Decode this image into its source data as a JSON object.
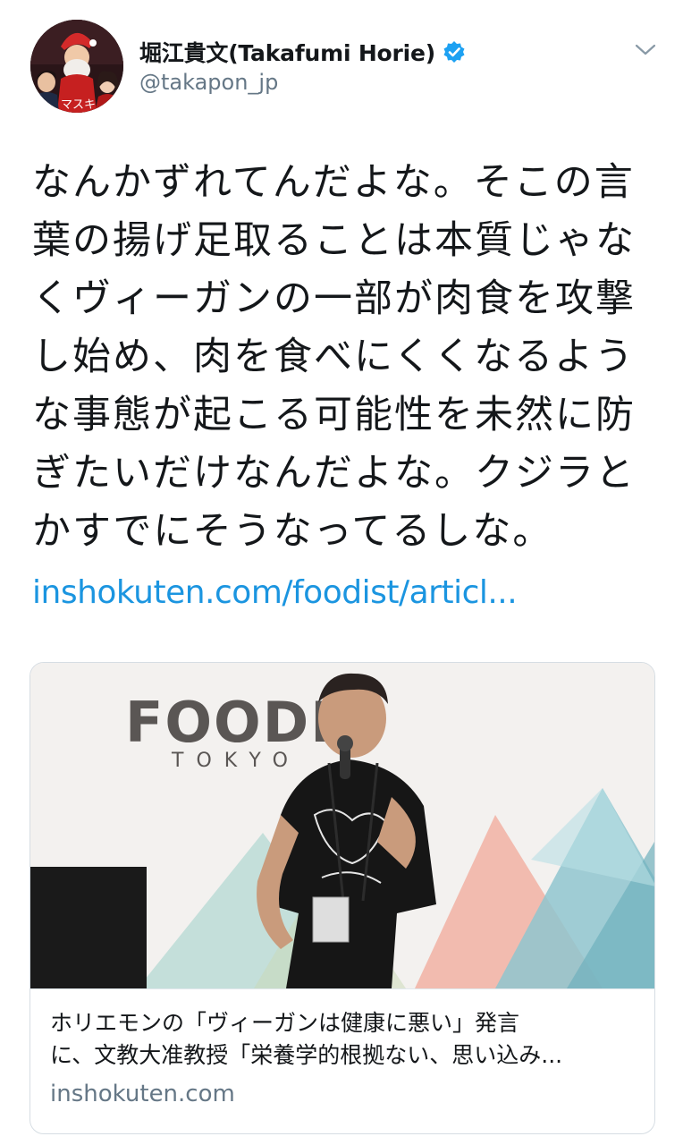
{
  "user": {
    "display_name": "堀江貴文(Takafumi Horie)",
    "handle": "@takapon_jp",
    "avatar_caption": "マスキ",
    "verified": true
  },
  "tweet": {
    "text": "なんかずれてんだよな。そこの言\n葉の揚げ足取ることは本質じゃな\nくヴィーガンの一部が肉食を攻撃\nし始め、肉を食べにくくなるよう\nな事態が起こる可能性を未然に防\nぎたいだけなんだよな。クジラと\nかすでにそうなってるしな。",
    "link": "inshokuten.com/foodist/articl..."
  },
  "card": {
    "image_sign_main": "FOODIT",
    "image_sign_sub": "TOKYO",
    "title": "ホリエモンの「ヴィーガンは健康に悪い」発言\nに、文教大准教授「栄養学的根拠ない、思い込み...",
    "domain": "inshokuten.com"
  },
  "colors": {
    "link": "#1b95e0",
    "secondary_text": "#657786",
    "verified_badge": "#1da1f2"
  },
  "icons": [
    "verified-badge-icon",
    "chevron-down-icon"
  ]
}
